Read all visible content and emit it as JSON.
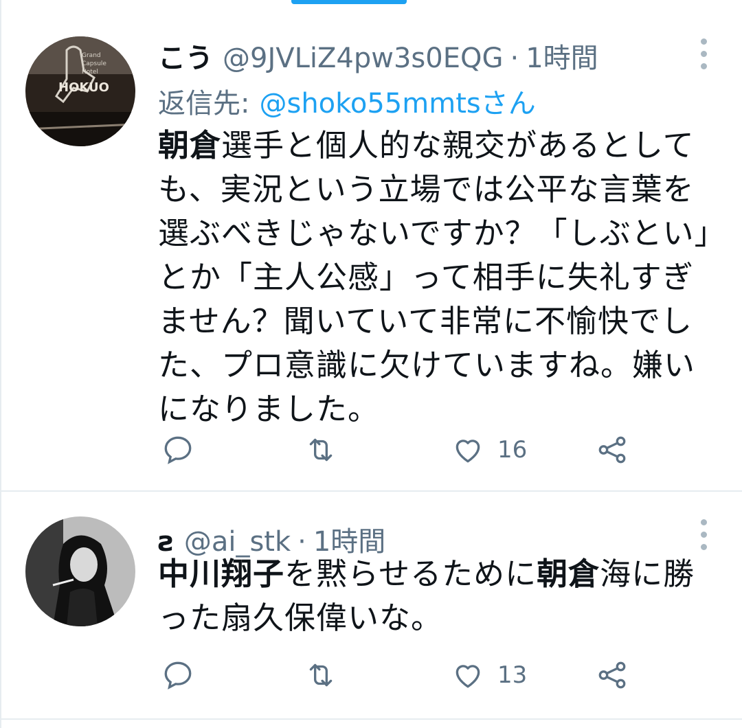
{
  "tweets": [
    {
      "name": "こう",
      "handle": "@9JVLiZ4pw3s0EQG",
      "separator": "·",
      "time": "1時間",
      "reply_label": "返信先:",
      "reply_to": "@shoko55mmtsさん",
      "body_bold_1": "朝倉",
      "body_rest_1": "選手と個人的な親交があるとしても、実況という立場では公平な言葉を選ぶべきじゃないですか？「しぶとい」とか「主人公感」って相手に失礼すぎません？聞いていて非常に不愉快でした、プロ意識に欠けていますね。嫌いになりました。",
      "like_count": "16",
      "avatar_text": "HOKUO"
    },
    {
      "name": "ƨ",
      "handle": "@ai_stk",
      "separator": "·",
      "time": "1時間",
      "body_bold_1": "中川翔子",
      "body_mid": "を黙らせるために",
      "body_bold_2": "朝倉",
      "body_rest": "海に勝った扇久保偉いな。",
      "like_count": "13"
    }
  ],
  "colors": {
    "accent": "#1da1f2",
    "muted": "#5b7083",
    "text": "#0f1419"
  },
  "icons": [
    "reply-icon",
    "retweet-icon",
    "like-icon",
    "share-icon",
    "more-icon"
  ]
}
